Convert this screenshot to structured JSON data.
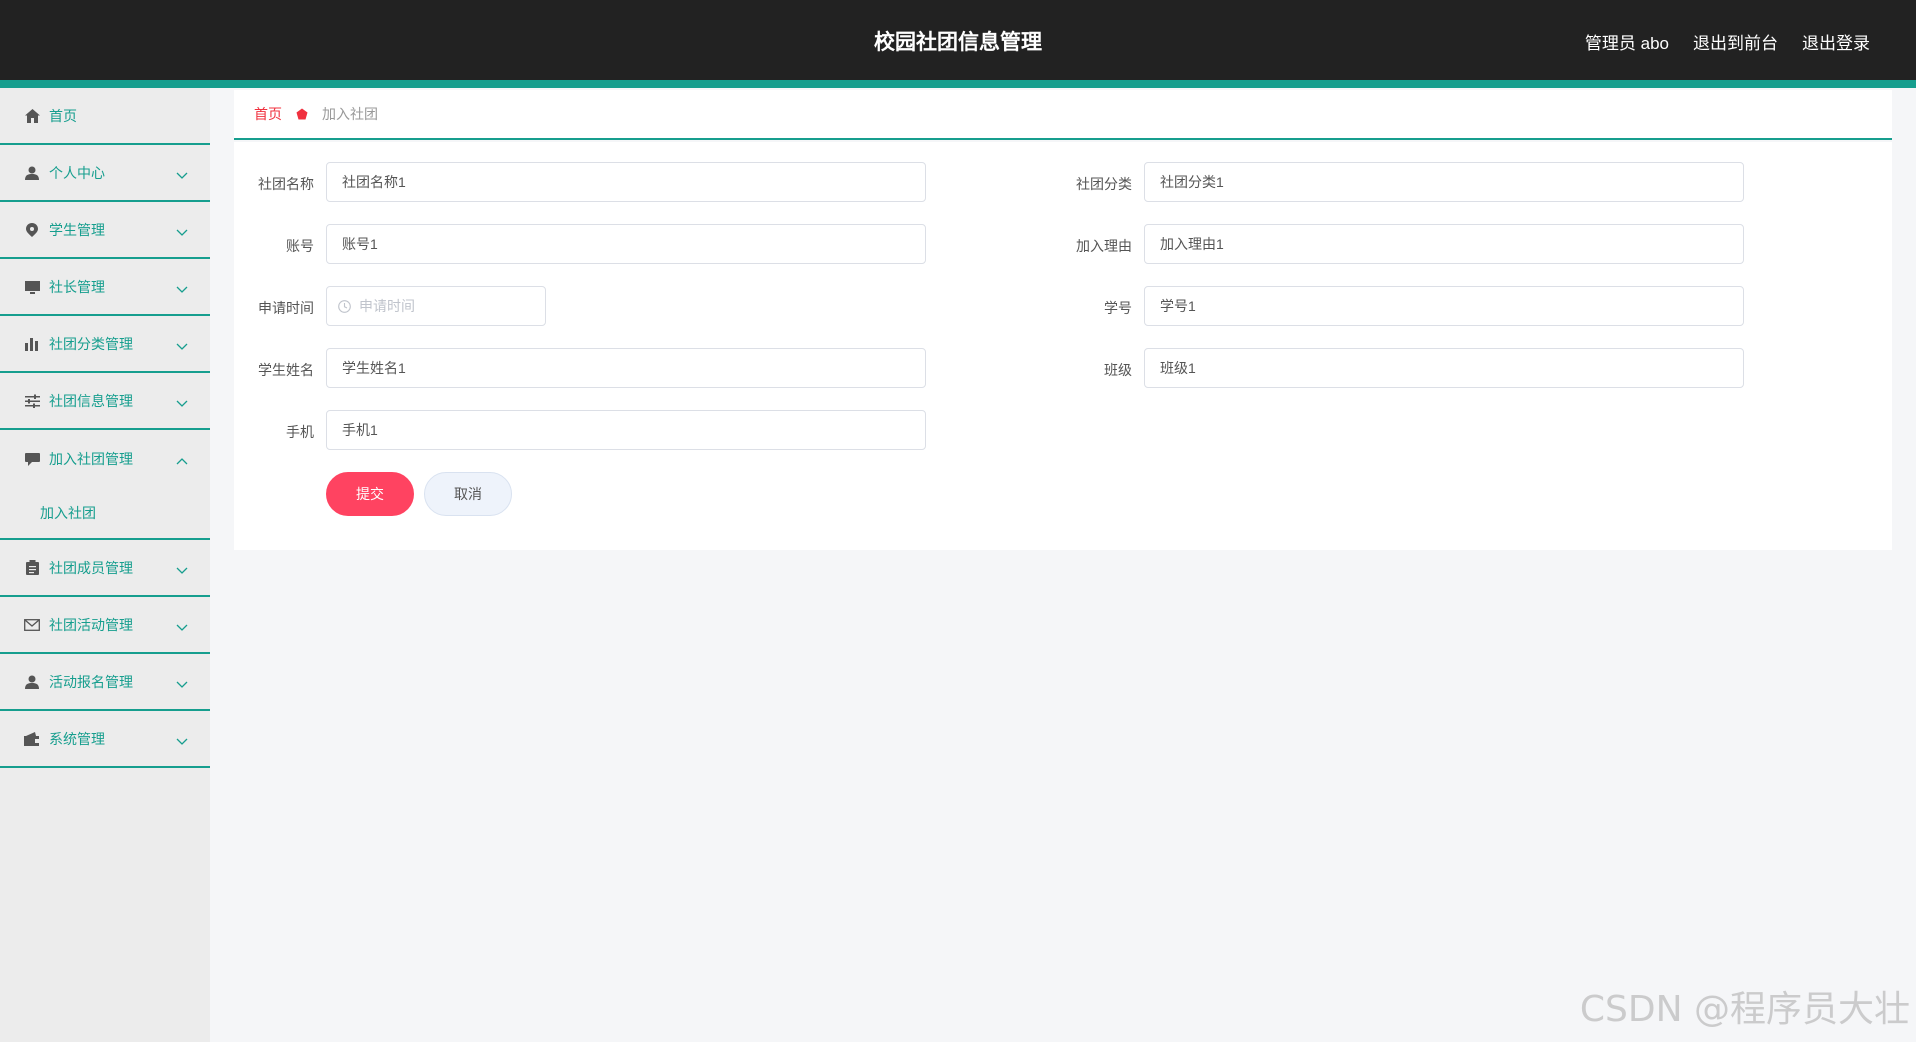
{
  "header": {
    "title": "校园社团信息管理",
    "user": "管理员 abo",
    "to_front": "退出到前台",
    "logout": "退出登录"
  },
  "sidebar": {
    "items": [
      {
        "label": "首页",
        "icon": "home-icon"
      },
      {
        "label": "个人中心",
        "icon": "user-icon"
      },
      {
        "label": "学生管理",
        "icon": "location-icon"
      },
      {
        "label": "社长管理",
        "icon": "monitor-icon"
      },
      {
        "label": "社团分类管理",
        "icon": "bar-chart-icon"
      },
      {
        "label": "社团信息管理",
        "icon": "sliders-icon"
      },
      {
        "label": "加入社团管理",
        "icon": "chat-icon",
        "expanded": true,
        "sub": "加入社团"
      },
      {
        "label": "社团成员管理",
        "icon": "clipboard-icon"
      },
      {
        "label": "社团活动管理",
        "icon": "mail-icon"
      },
      {
        "label": "活动报名管理",
        "icon": "user-icon"
      },
      {
        "label": "系统管理",
        "icon": "wallet-icon"
      }
    ],
    "accent": "#169e8e"
  },
  "breadcrumb": {
    "home": "首页",
    "current": "加入社团"
  },
  "form": {
    "club_name": {
      "label": "社团名称",
      "value": "社团名称1"
    },
    "club_category": {
      "label": "社团分类",
      "value": "社团分类1"
    },
    "account": {
      "label": "账号",
      "value": "账号1"
    },
    "reason": {
      "label": "加入理由",
      "value": "加入理由1"
    },
    "apply_time": {
      "label": "申请时间",
      "placeholder": "申请时间"
    },
    "student_no": {
      "label": "学号",
      "value": "学号1"
    },
    "student_name": {
      "label": "学生姓名",
      "value": "学生姓名1"
    },
    "class": {
      "label": "班级",
      "value": "班级1"
    },
    "phone": {
      "label": "手机",
      "value": "手机1"
    },
    "submit_label": "提交",
    "cancel_label": "取消"
  },
  "watermark": "CSDN @程序员大壮"
}
